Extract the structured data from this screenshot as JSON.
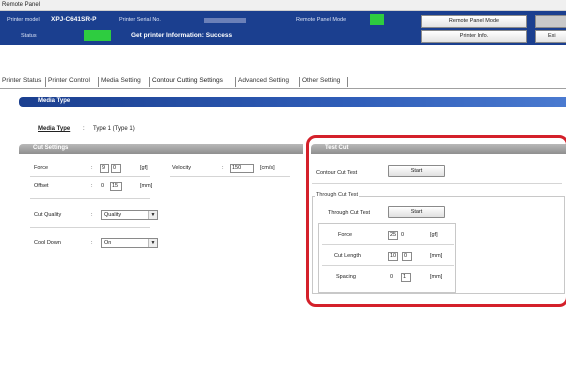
{
  "window": {
    "title": "Remote Panel"
  },
  "header": {
    "printer_model_label": "Printer model",
    "printer_model_value": "XPJ-C641SR-P",
    "printer_serial_label": "Printer Serial No.",
    "remote_mode_label": "Remote Panel Mode",
    "status_label": "Status",
    "status_message": "Get printer Information: Success",
    "remote_mode_button": "Remote Panel Mode",
    "printer_info_button": "Printer Info.",
    "exit_button": "Exi",
    "status_color": "#2ecc40"
  },
  "tabs": [
    {
      "label": "Printer Status"
    },
    {
      "label": "Printer Control"
    },
    {
      "label": "Media Setting"
    },
    {
      "label": "Contour Cutting Settings"
    },
    {
      "label": "Advanced Setting"
    },
    {
      "label": "Other Setting"
    }
  ],
  "media_type": {
    "section_title": "Media Type",
    "label": "Media Type",
    "colon": ":",
    "value": "Type 1 (Type 1)"
  },
  "cut_settings": {
    "section_title": "Cut Settings",
    "force": {
      "label": "Force",
      "colon": ":",
      "value1": "9",
      "value2": "0",
      "unit": "[gf]"
    },
    "velocity": {
      "label": "Velocity",
      "colon": ":",
      "value": "150",
      "unit": "[cm/s]"
    },
    "offset": {
      "label": "Offset",
      "colon": ":",
      "value1": "0",
      "value2": "15",
      "unit": "[mm]"
    },
    "cut_quality": {
      "label": "Cut Quality",
      "colon": ":",
      "value": "Quality"
    },
    "cool_down": {
      "label": "Cool Down",
      "colon": ":",
      "value": "On"
    }
  },
  "test_cut": {
    "section_title": "Test Cut",
    "contour_cut_test": {
      "label": "Contour Cut Test",
      "button": "Start"
    },
    "through_cut_group": {
      "title": "Through Cut Test",
      "through_cut_test": {
        "label": "Through Cut Test",
        "button": "Start"
      },
      "force": {
        "label": "Force",
        "value1": "25",
        "value2": "0",
        "unit": "[gf]"
      },
      "cut_length": {
        "label": "Cut Length",
        "value1": "10",
        "value2": "0",
        "unit": "[mm]"
      },
      "spacing": {
        "label": "Spacing",
        "value1": "0",
        "value2": "1",
        "unit": "[mm]"
      }
    }
  },
  "colors": {
    "accent": "#1b3f8f",
    "highlight": "#d4202a"
  }
}
